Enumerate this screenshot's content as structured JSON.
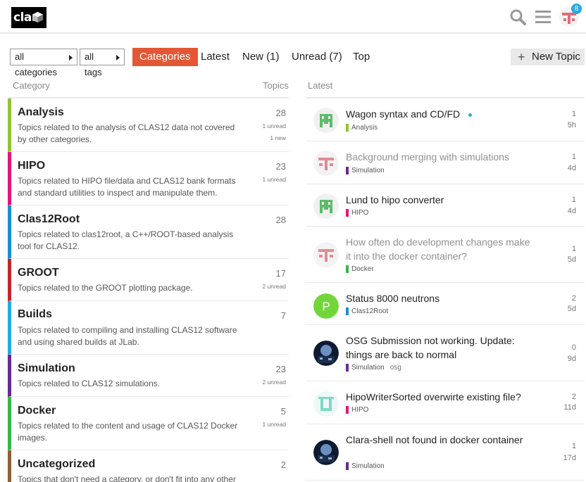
{
  "header": {
    "logo_text": "clas",
    "notification_count": "8",
    "icons": [
      "search-icon",
      "hamburger-menu-icon",
      "user-avatar"
    ]
  },
  "nav": {
    "category_filter": "all categories",
    "tag_filter": "all tags",
    "tabs": [
      {
        "label": "Categories",
        "active": true
      },
      {
        "label": "Latest",
        "active": false
      },
      {
        "label": "New (1)",
        "active": false
      },
      {
        "label": "Unread (7)",
        "active": false
      },
      {
        "label": "Top",
        "active": false
      }
    ],
    "new_topic_label": "New Topic"
  },
  "columns": {
    "category": "Category",
    "topics": "Topics",
    "latest": "Latest"
  },
  "categories": [
    {
      "name": "Analysis",
      "color": "#92c23a",
      "count": "28",
      "unread": "1 unread",
      "new": "1 new",
      "desc": "Topics related to the analysis of CLAS12 data not covered by other categories."
    },
    {
      "name": "HIPO",
      "color": "#e4167a",
      "count": "23",
      "unread": "1 unread",
      "new": "",
      "desc": "Topics related to HIPO file/data and CLAS12 bank formats and standard utilities to inspect and manipulate them."
    },
    {
      "name": "Clas12Root",
      "color": "#1e8ecf",
      "count": "28",
      "unread": "",
      "new": "",
      "desc": "Topics related to clas12root, a C++/ROOT-based analysis tool for CLAS12."
    },
    {
      "name": "GROOT",
      "color": "#c1272d",
      "count": "17",
      "unread": "2 unread",
      "new": "",
      "desc": "Topics related to the GROOT plotting package."
    },
    {
      "name": "Builds",
      "color": "#25aae2",
      "count": "7",
      "unread": "",
      "new": "",
      "desc": "Topics related to compiling and installing CLAS12 software and using shared builds at JLab."
    },
    {
      "name": "Simulation",
      "color": "#652d90",
      "count": "23",
      "unread": "2 unread",
      "new": "",
      "desc": "Topics related to CLAS12 simulations."
    },
    {
      "name": "Docker",
      "color": "#3ab54a",
      "count": "5",
      "unread": "1 unread",
      "new": "",
      "desc": "Topics related to the content and usage of CLAS12 Docker images."
    },
    {
      "name": "Uncategorized",
      "color": "#8c6238",
      "count": "2",
      "unread": "",
      "new": "",
      "desc": "Topics that don't need a category, or don't fit into any other"
    }
  ],
  "topics": [
    {
      "title": "Wagon syntax and CD/FD",
      "read": false,
      "new_dot": true,
      "category": "Analysis",
      "cat_color": "#92c23a",
      "tag": "",
      "posts": "1",
      "age": "5h",
      "avatar": "green-invader"
    },
    {
      "title": "Background merging with simulations",
      "read": true,
      "new_dot": false,
      "category": "Simulation",
      "cat_color": "#652d90",
      "tag": "",
      "posts": "1",
      "age": "4d",
      "avatar": "pink-cross"
    },
    {
      "title": "Lund to hipo converter",
      "read": false,
      "new_dot": false,
      "category": "HIPO",
      "cat_color": "#e4167a",
      "tag": "",
      "posts": "1",
      "age": "4d",
      "avatar": "green-invader"
    },
    {
      "title": "How often do development changes make it into the docker container?",
      "read": true,
      "new_dot": false,
      "category": "Docker",
      "cat_color": "#3ab54a",
      "tag": "",
      "posts": "1",
      "age": "5d",
      "avatar": "pink-cross"
    },
    {
      "title": "Status 8000 neutrons",
      "read": false,
      "new_dot": false,
      "category": "Clas12Root",
      "cat_color": "#1e8ecf",
      "tag": "",
      "posts": "2",
      "age": "5d",
      "avatar": "letter-p",
      "avatar_letter": "P"
    },
    {
      "title": "OSG Submission not working. Update: things are back to normal",
      "read": false,
      "new_dot": false,
      "category": "Simulation",
      "cat_color": "#652d90",
      "tag": "osg",
      "posts": "0",
      "age": "9d",
      "avatar": "photo"
    },
    {
      "title": "HipoWriterSorted overwirte existing file?",
      "read": false,
      "new_dot": false,
      "category": "HIPO",
      "cat_color": "#e4167a",
      "tag": "",
      "posts": "2",
      "age": "11d",
      "avatar": "teal-u"
    },
    {
      "title": "Clara-shell not found in docker container",
      "read": false,
      "new_dot": false,
      "category": "Simulation",
      "cat_color": "#652d90",
      "tag": "",
      "posts": "1",
      "age": "17d",
      "avatar": "photo"
    }
  ]
}
